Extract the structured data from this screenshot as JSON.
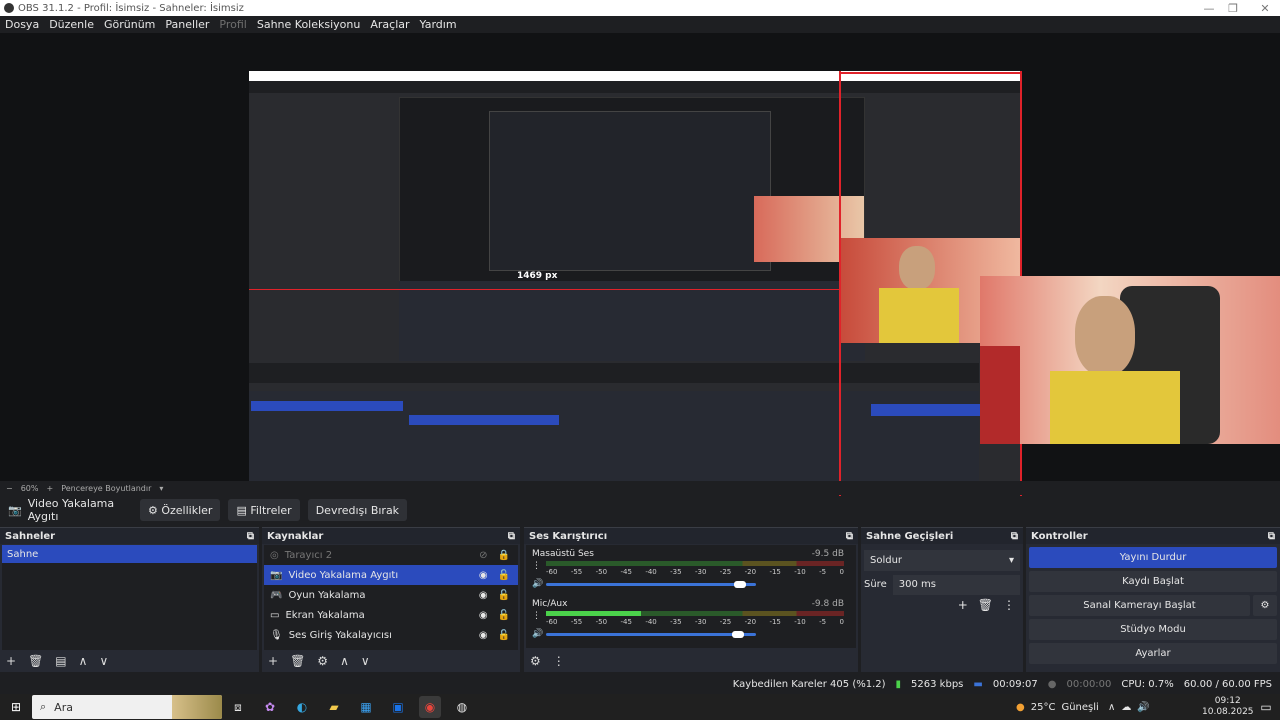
{
  "window": {
    "title": "OBS 31.1.2 - Profil: İsimsiz - Sahneler: İsimsiz"
  },
  "menu": [
    "Dosya",
    "Düzenle",
    "Görünüm",
    "Paneller",
    "Profil",
    "Sahne Koleksiyonu",
    "Araçlar",
    "Yardım"
  ],
  "preview": {
    "zoom": "60%",
    "fit_label": "Pencereye Boyutlandır",
    "measure_label": "1469 px"
  },
  "source_toolbar": {
    "current": "Video Yakalama Aygıtı",
    "properties": "Özellikler",
    "filters": "Filtreler",
    "deactivate": "Devredışı Bırak"
  },
  "scenes": {
    "title": "Sahneler",
    "items": [
      "Sahne"
    ]
  },
  "sources": {
    "title": "Kaynaklar",
    "items": [
      {
        "label": "Tarayıcı 2",
        "icon": "browser-icon",
        "visible": false
      },
      {
        "label": "Video Yakalama Aygıtı",
        "icon": "camera-icon",
        "visible": true,
        "selected": true
      },
      {
        "label": "Oyun Yakalama",
        "icon": "gamepad-icon",
        "visible": true
      },
      {
        "label": "Ekran Yakalama",
        "icon": "monitor-icon",
        "visible": true
      },
      {
        "label": "Ses Giriş Yakalayıcısı",
        "icon": "mic-icon",
        "visible": true
      }
    ]
  },
  "mixer": {
    "title": "Ses Karıştırıcı",
    "ticks": [
      "-60",
      "-55",
      "-50",
      "-45",
      "-40",
      "-35",
      "-30",
      "-25",
      "-20",
      "-15",
      "-10",
      "-5",
      "0"
    ],
    "channels": [
      {
        "name": "Masaüstü Ses",
        "db": "-9.5 dB",
        "level": 0.0
      },
      {
        "name": "Mic/Aux",
        "db": "-9.8 dB",
        "level": 0.32
      }
    ]
  },
  "transitions": {
    "title": "Sahne Geçişleri",
    "type": "Soldur",
    "duration_label": "Süre",
    "duration": "300 ms"
  },
  "controls": {
    "title": "Kontroller",
    "stream": "Yayını Durdur",
    "record": "Kaydı Başlat",
    "vcam": "Sanal Kamerayı Başlat",
    "studio": "Stüdyo Modu",
    "settings": "Ayarlar"
  },
  "status": {
    "dropped": "Kaybedilen Kareler 405 (%1.2)",
    "bitrate": "5263 kbps",
    "stream_time": "00:09:07",
    "rec_time": "00:00:00",
    "cpu": "CPU: 0.7%",
    "fps": "60.00 / 60.00 FPS"
  },
  "taskbar": {
    "search": "Ara",
    "weather": "25°C",
    "weather_desc": "Güneşli",
    "time": "09:12",
    "date": "10.08.2025"
  }
}
